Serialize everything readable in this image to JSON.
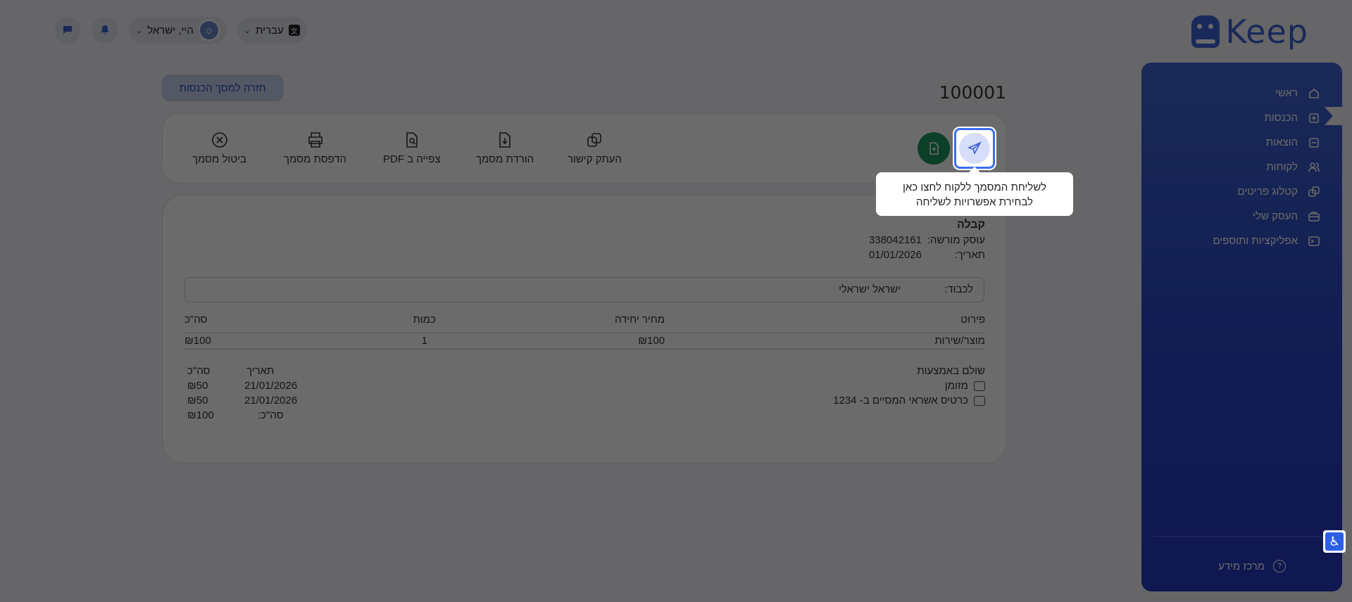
{
  "logo": {
    "text": "Keep"
  },
  "topbar": {
    "language": "עברית",
    "language_icon": "translate-icon",
    "user_name": "היי, ישראל",
    "notifications_icon": "bell-icon",
    "chat_icon": "chat-icon"
  },
  "sidebar": {
    "items": [
      {
        "label": "ראשי",
        "icon": "home-icon"
      },
      {
        "label": "הכנסות",
        "icon": "income-icon"
      },
      {
        "label": "הוצאות",
        "icon": "expenses-icon"
      },
      {
        "label": "לקוחות",
        "icon": "customers-icon"
      },
      {
        "label": "קטלוג פריטים",
        "icon": "catalog-icon"
      },
      {
        "label": "העסק שלי",
        "icon": "briefcase-icon"
      },
      {
        "label": "אפליקציות ותוספים",
        "icon": "apps-icon"
      }
    ],
    "help_label": "מרכז מידע"
  },
  "main": {
    "doc_number": "100001",
    "back_label": "חזרה למסך הכנסות",
    "actions": {
      "copy_link": "העתק קישור",
      "download": "הורדת מסמך",
      "pdf_view": "צפייה ב PDF",
      "print": "הדפסת מסמך",
      "cancel": "ביטול מסמך"
    }
  },
  "document": {
    "type": "קבלה",
    "dealer_label": "עוסק מורשה:",
    "dealer_value": "338042161",
    "date_label": "תאריך:",
    "date_value": "01/01/2026",
    "to_label": "לכבוד:",
    "to_value": "ישראל ישראלי",
    "columns": {
      "desc": "פירוט",
      "unit_price": "מחיר יחידה",
      "qty": "כמות",
      "total": "סה\"כ"
    },
    "rows": [
      {
        "desc": "מוצר/שירות",
        "unit_price": "₪100",
        "qty": "1",
        "total": "₪100"
      }
    ],
    "payments_title": "שולם באמצעות",
    "payments": [
      {
        "method": "מזומן",
        "date": "21/01/2026",
        "amount": "₪50"
      },
      {
        "method": "כרטיס אשראי המסיים ב- 1234",
        "date": "21/01/2026",
        "amount": "₪50"
      }
    ],
    "pay_cols": {
      "date": "תאריך",
      "total": "סה\"כ"
    },
    "pay_total_label": "סה\"כ:",
    "pay_total_value": "₪100"
  },
  "tooltip": {
    "line1": "לשליחת המסמך ללקוח לחצו כאן",
    "line2": "לבחירת אפשרויות לשליחה"
  },
  "colors": {
    "brand": "#3c62d6",
    "sidebar": "#2a45c4",
    "green": "#1e9a62",
    "overlay": "rgba(0,0,0,0.58)"
  }
}
